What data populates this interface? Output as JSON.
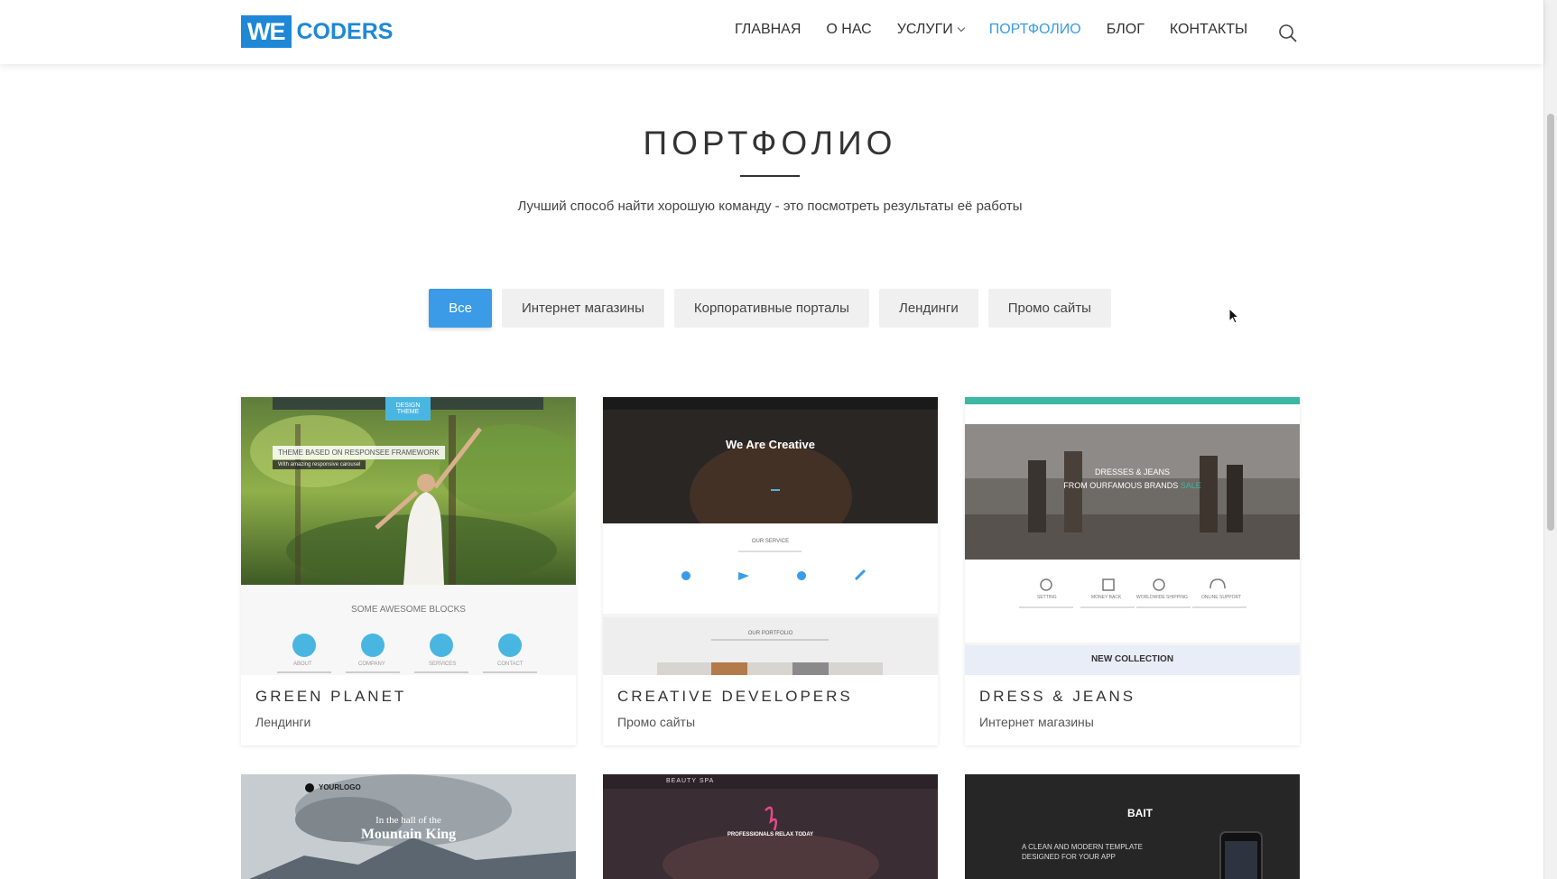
{
  "header": {
    "logo_box": "WE",
    "logo_text": "CODERS",
    "nav": [
      {
        "label": "ГЛАВНАЯ"
      },
      {
        "label": "О НАС"
      },
      {
        "label": "УСЛУГИ"
      },
      {
        "label": "ПОРТФОЛИО",
        "active": true
      },
      {
        "label": "БЛОГ"
      },
      {
        "label": "КОНТАКТЫ"
      }
    ]
  },
  "hero": {
    "title": "ПОРТФОЛИО",
    "subtitle": "Лучший способ найти хорошую команду - это посмотреть результаты её работы"
  },
  "filters": [
    {
      "label": "Все",
      "active": true
    },
    {
      "label": "Интернет магазины"
    },
    {
      "label": "Корпоративные порталы"
    },
    {
      "label": "Лендинги"
    },
    {
      "label": "Промо сайты"
    }
  ],
  "cards": [
    {
      "title": "GREEN PLANET",
      "category": "Лендинги",
      "thumb_banner": "THEME BASED ON RESPONSEE FRAMEWORK",
      "thumb_banner_sub": "With amazing responsive carousel",
      "thumb_menu_active": "DESIGN THEME",
      "thumb_section": "SOME AWESOME BLOCKS",
      "thumb_icons": [
        "ABOUT",
        "COMPANY",
        "SERVICES",
        "CONTACT"
      ]
    },
    {
      "title": "CREATIVE DEVELOPERS",
      "category": "Промо сайты",
      "thumb_headline": "We Are Creative",
      "thumb_section": "OUR SERVICE",
      "thumb_section2": "OUR PORTFOLIO"
    },
    {
      "title": "DRESS & JEANS",
      "category": "Интернет магазины",
      "thumb_headline1": "DRESSES & JEANS",
      "thumb_headline2": "FROM OURFAMOUS BRANDS",
      "thumb_sale": "SALE",
      "thumb_features": [
        "SETTING",
        "MONEY BACK",
        "WORLDWIDE SHIPPING",
        "ONLINE SUPPORT"
      ],
      "thumb_collection": "NEW COLLECTION"
    }
  ],
  "row2": [
    {
      "logo": "YOURLOGO",
      "line1": "In the hall of the",
      "line2": "Mountain King"
    },
    {
      "brand": "BEAUTY SPA",
      "headline": "PROFESSIONALS RELAX TODAY"
    },
    {
      "brand": "BAIT",
      "line1": "A CLEAN AND MODERN TEMPLATE",
      "line2": "DESIGNED FOR YOUR APP"
    }
  ],
  "colors": {
    "accent": "#3b9be6",
    "logo": "#1e88d6",
    "filter_bg": "#f0f0f0"
  }
}
